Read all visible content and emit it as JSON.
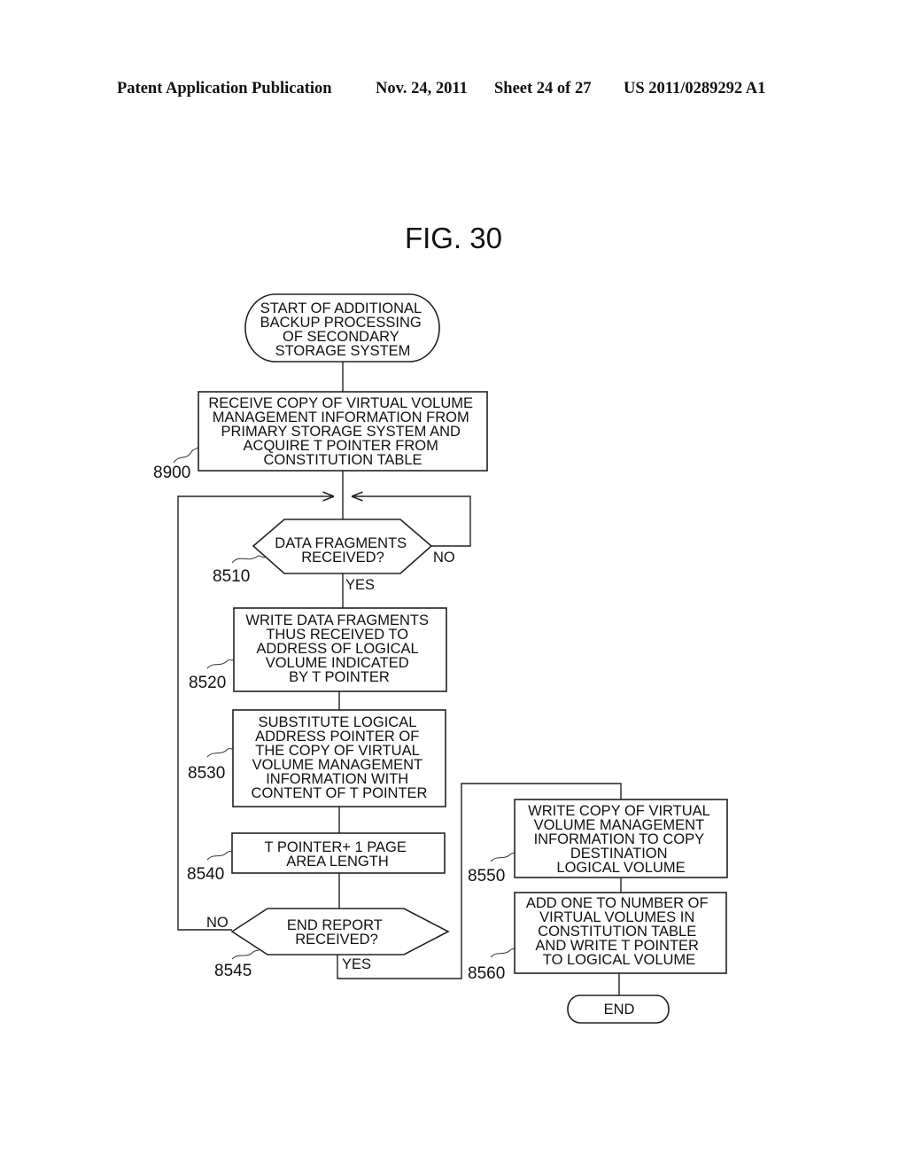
{
  "header": {
    "publication": "Patent Application Publication",
    "date": "Nov. 24, 2011",
    "sheet": "Sheet 24 of 27",
    "number": "US 2011/0289292 A1"
  },
  "figure": {
    "title": "FIG. 30"
  },
  "flowchart": {
    "start": {
      "lines": [
        "START OF ADDITIONAL",
        "BACKUP PROCESSING",
        "OF SECONDARY",
        "STORAGE SYSTEM"
      ]
    },
    "steps": {
      "s8900": {
        "ref": "8900",
        "lines": [
          "RECEIVE COPY OF VIRTUAL VOLUME",
          "MANAGEMENT INFORMATION FROM",
          "PRIMARY STORAGE SYSTEM AND",
          "ACQUIRE T POINTER FROM",
          "CONSTITUTION TABLE"
        ]
      },
      "s8510": {
        "ref": "8510",
        "lines": [
          "DATA FRAGMENTS",
          "RECEIVED?"
        ],
        "yes": "YES",
        "no": "NO"
      },
      "s8520": {
        "ref": "8520",
        "lines": [
          "WRITE DATA FRAGMENTS",
          "THUS RECEIVED TO",
          "ADDRESS OF LOGICAL",
          "VOLUME INDICATED",
          "BY T POINTER"
        ]
      },
      "s8530": {
        "ref": "8530",
        "lines": [
          "SUBSTITUTE LOGICAL",
          "ADDRESS POINTER OF",
          "THE COPY OF VIRTUAL",
          "VOLUME MANAGEMENT",
          "INFORMATION WITH",
          "CONTENT OF T POINTER"
        ]
      },
      "s8540": {
        "ref": "8540",
        "lines": [
          "T POINTER+ 1 PAGE",
          "AREA LENGTH"
        ]
      },
      "s8545": {
        "ref": "8545",
        "lines": [
          "END REPORT",
          "RECEIVED?"
        ],
        "yes": "YES",
        "no": "NO"
      },
      "s8550": {
        "ref": "8550",
        "lines": [
          "WRITE COPY OF VIRTUAL",
          "VOLUME MANAGEMENT",
          "INFORMATION TO COPY",
          "DESTINATION",
          "LOGICAL VOLUME"
        ]
      },
      "s8560": {
        "ref": "8560",
        "lines": [
          "ADD ONE TO NUMBER OF",
          "VIRTUAL VOLUMES IN",
          "CONSTITUTION TABLE",
          "AND WRITE T POINTER",
          "TO LOGICAL VOLUME"
        ]
      }
    },
    "end": {
      "label": "END"
    }
  }
}
